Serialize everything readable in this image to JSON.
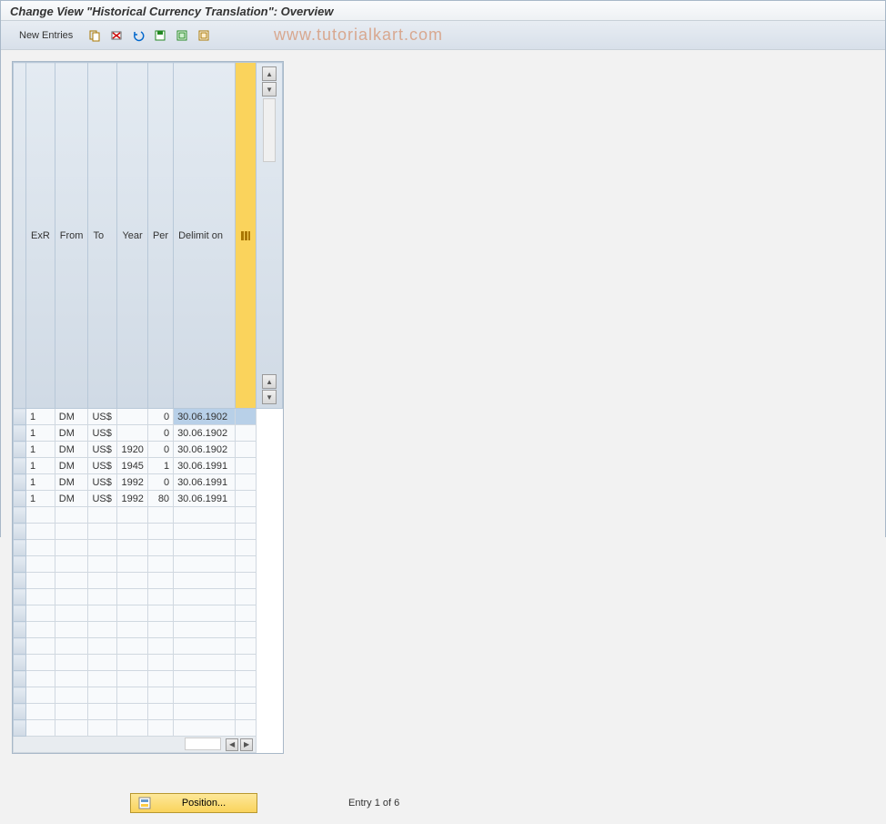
{
  "title": "Change View \"Historical Currency Translation\": Overview",
  "toolbar": {
    "new_entries_label": "New Entries"
  },
  "watermark": "www.tutorialkart.com",
  "table": {
    "headers": {
      "exr": "ExR",
      "from": "From",
      "to": "To",
      "year": "Year",
      "per": "Per",
      "delimit": "Delimit on"
    },
    "rows": [
      {
        "exr": "1",
        "from": "DM",
        "to": "US$",
        "year": "",
        "per": "0",
        "delimit": "30.06.1902",
        "selected": true
      },
      {
        "exr": "1",
        "from": "DM",
        "to": "US$",
        "year": "",
        "per": "0",
        "delimit": "30.06.1902"
      },
      {
        "exr": "1",
        "from": "DM",
        "to": "US$",
        "year": "1920",
        "per": "0",
        "delimit": "30.06.1902"
      },
      {
        "exr": "1",
        "from": "DM",
        "to": "US$",
        "year": "1945",
        "per": "1",
        "delimit": "30.06.1991"
      },
      {
        "exr": "1",
        "from": "DM",
        "to": "US$",
        "year": "1992",
        "per": "0",
        "delimit": "30.06.1991"
      },
      {
        "exr": "1",
        "from": "DM",
        "to": "US$",
        "year": "1992",
        "per": "80",
        "delimit": "30.06.1991"
      }
    ],
    "empty_row_count": 14
  },
  "footer": {
    "position_label": "Position...",
    "entry_info": "Entry 1 of 6"
  }
}
